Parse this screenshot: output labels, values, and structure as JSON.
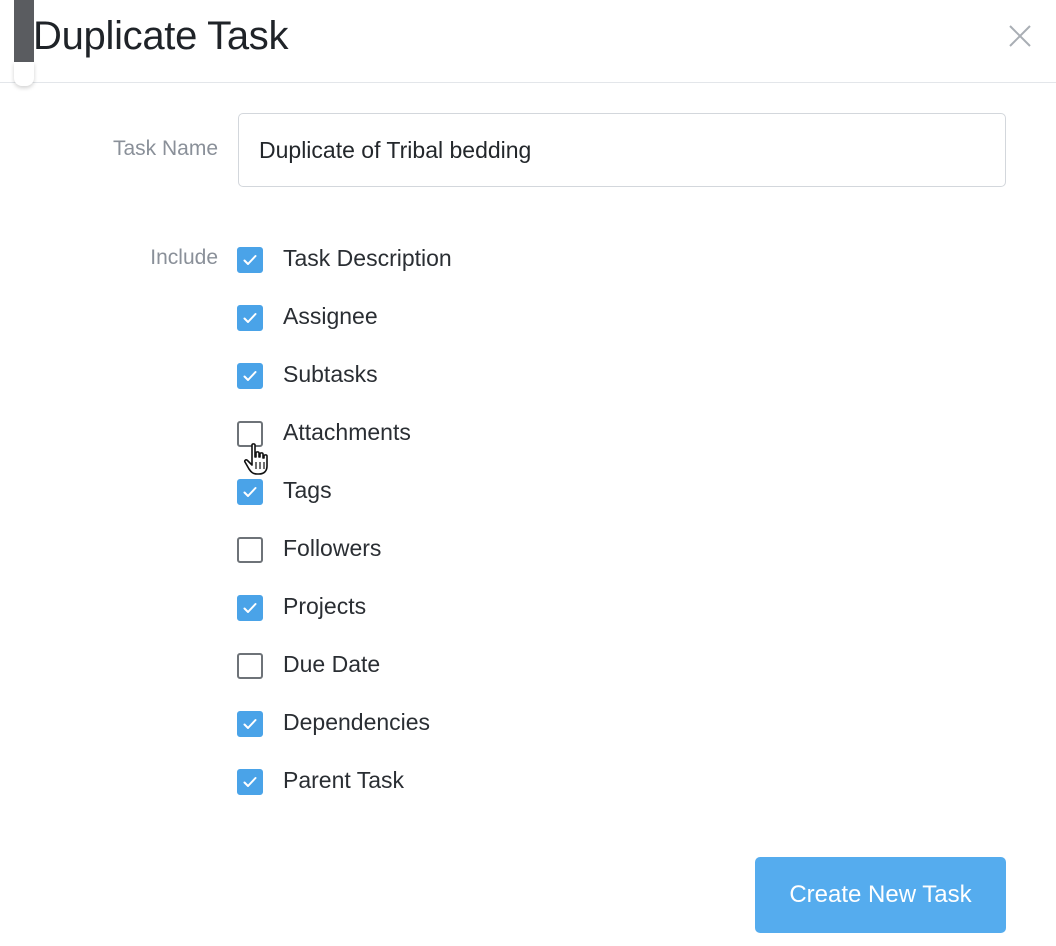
{
  "dialog": {
    "title": "Duplicate Task",
    "close_icon": "close-icon"
  },
  "task_name": {
    "label": "Task Name",
    "value": "Duplicate of Tribal bedding"
  },
  "include": {
    "label": "Include",
    "options": [
      {
        "label": "Task Description",
        "checked": true
      },
      {
        "label": "Assignee",
        "checked": true
      },
      {
        "label": "Subtasks",
        "checked": true
      },
      {
        "label": "Attachments",
        "checked": false
      },
      {
        "label": "Tags",
        "checked": true
      },
      {
        "label": "Followers",
        "checked": false
      },
      {
        "label": "Projects",
        "checked": true
      },
      {
        "label": "Due Date",
        "checked": false
      },
      {
        "label": "Dependencies",
        "checked": true
      },
      {
        "label": "Parent Task",
        "checked": true
      }
    ]
  },
  "actions": {
    "create_label": "Create New Task"
  },
  "colors": {
    "accent": "#4aa3e8",
    "button": "#55acee",
    "label_text": "#8a9099"
  },
  "cursor_icon": "hand-pointer-icon"
}
